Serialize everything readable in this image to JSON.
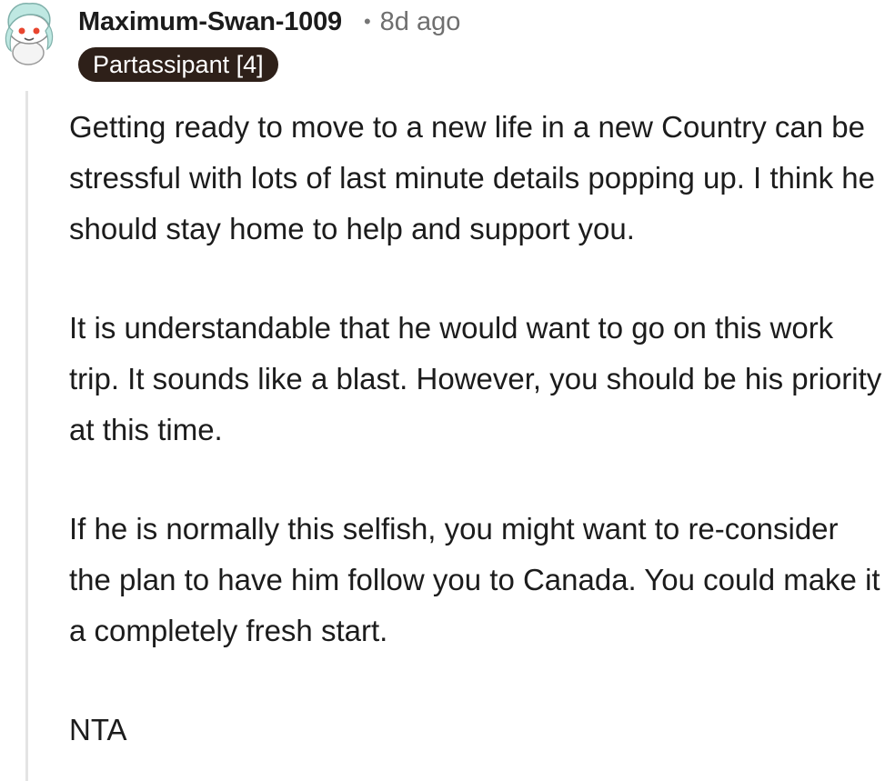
{
  "comment": {
    "username": "Maximum-Swan-1009",
    "separator": "•",
    "age": "8d ago",
    "flair": "Partassipant [4]",
    "avatar_icon": "snoo-avatar-icon",
    "paragraphs": [
      "Getting ready to move to a new life in a new Country can be stressful with lots of last minute details popping up. I think he should stay home to help and support you.",
      "It is understandable that he would want to go on this work trip. It sounds like a blast. However, you should be his priority at this time.",
      "If he is normally this selfish, you might want to re-consider the plan to have him follow you to Canada. You could make it a completely fresh start.",
      "NTA"
    ]
  },
  "colors": {
    "flair_bg": "#2e2019",
    "flair_text": "#ffffff",
    "thread_line": "#e4e4e4",
    "meta_text": "#6f6f6f"
  }
}
